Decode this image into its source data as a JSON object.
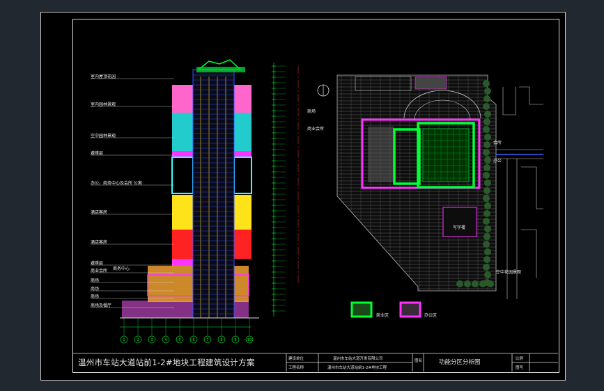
{
  "colors": {
    "background": "#212830",
    "sheet": "#000000",
    "frame": "#e0e0e0",
    "green_zone": "#00ff33",
    "magenta_zone": "#ff33ff",
    "cyan_zone": "#33e6e6",
    "yellow_zone": "#ffe31a",
    "red_zone": "#ff2222",
    "orange_zone": "#ffaa33"
  },
  "elevation_labels": [
    "室内屋顶花园",
    "室内园林景观",
    "空中园林景观",
    "避难层",
    "办公、商务中心及会所 公寓",
    "酒店客房",
    "酒店客房",
    "避难层",
    "商业会所",
    "商场",
    "商场",
    "商场",
    "商场及餐厅"
  ],
  "elevation_sublabel": "商务中心",
  "plan_labels": {
    "top_left_1": "商场",
    "top_left_2": "商业会所",
    "right_1": "会所",
    "right_2": "办公",
    "bottom_right_1": "写字楼",
    "bottom_right_2": "空中花园景观"
  },
  "legend": [
    {
      "label": "商业区",
      "color": "#00ff33"
    },
    {
      "label": "办公区",
      "color": "#ff33ff"
    }
  ],
  "title_block": {
    "project_title": "温州市车站大道站前1-2#地块工程建筑设计方案",
    "cell_1": "建设单位",
    "cell_2": "工程名称",
    "cell_3": "温州市车站大道开发有限公司",
    "cell_4": "温州市车站大道站前1-2#地块工程",
    "cell_5": "图名",
    "cell_6": "功能分区分析图",
    "cell_7": "比例",
    "cell_8": "图号"
  },
  "axis_numbers": [
    "1",
    "2",
    "3",
    "4",
    "5",
    "6",
    "7",
    "8",
    "9",
    "10"
  ]
}
